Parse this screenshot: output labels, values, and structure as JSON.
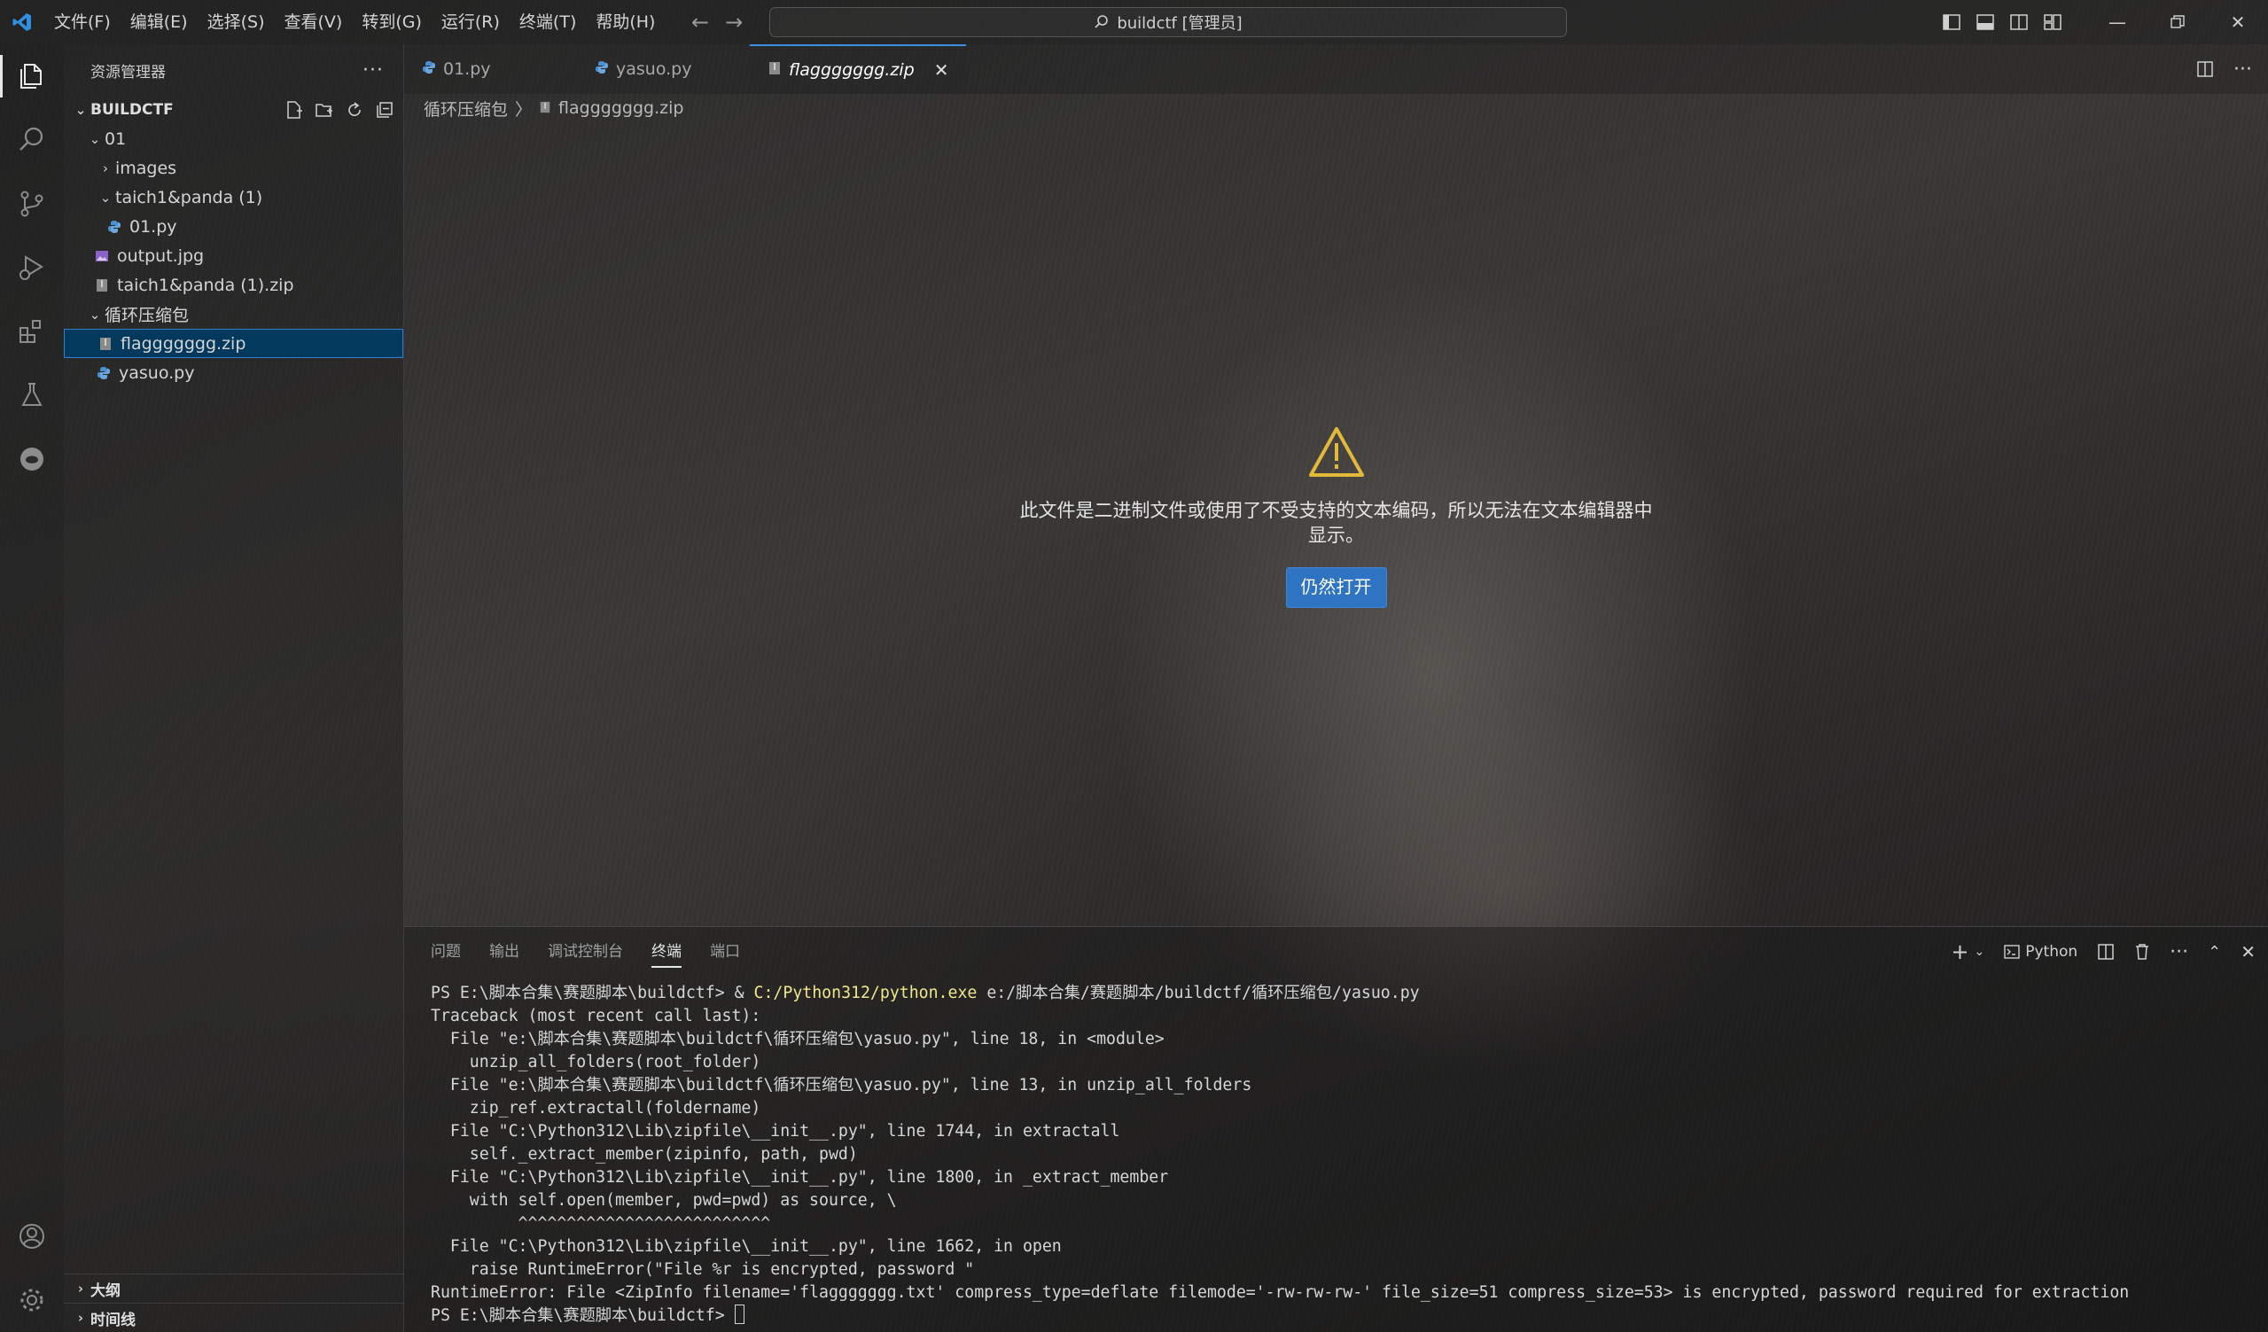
{
  "menu": [
    "文件(F)",
    "编辑(E)",
    "选择(S)",
    "查看(V)",
    "转到(G)",
    "运行(R)",
    "终端(T)",
    "帮助(H)"
  ],
  "command_center": {
    "text": "buildctf [管理员]",
    "icon": "search-icon"
  },
  "explorer": {
    "title": "资源管理器",
    "more": "···",
    "root": "BUILDCTF",
    "tree": [
      {
        "label": "01"
      },
      {
        "label": "images"
      },
      {
        "label": "taich1&panda (1)"
      },
      {
        "label": "01.py"
      },
      {
        "label": "output.jpg"
      },
      {
        "label": "taich1&panda (1).zip"
      },
      {
        "label": "循环压缩包"
      },
      {
        "label": "flaggggggg.zip"
      },
      {
        "label": "yasuo.py"
      }
    ],
    "bottom_sections": [
      "大纲",
      "时间线"
    ]
  },
  "tabs": [
    {
      "label": "01.py",
      "icon": "python-file-icon"
    },
    {
      "label": "yasuo.py",
      "icon": "python-file-icon"
    },
    {
      "label": "flaggggggg.zip",
      "icon": "zip-file-icon",
      "close": "✕"
    }
  ],
  "breadcrumb": {
    "folder": "循环压缩包",
    "sep": "〉",
    "file": "flaggggggg.zip"
  },
  "binary_notice": {
    "message": "此文件是二进制文件或使用了不受支持的文本编码，所以无法在文本编辑器中显示。",
    "button": "仍然打开"
  },
  "panel": {
    "tabs": [
      "问题",
      "输出",
      "调试控制台",
      "终端",
      "端口"
    ],
    "active_tab": "终端",
    "shell_label": "Python"
  },
  "terminal": {
    "prompt": "PS E:\\脚本合集\\赛题脚本\\buildctf> ",
    "first_cmd_amp": "& ",
    "first_cmd_exe": "C:/Python312/python.exe",
    "first_cmd_arg": " e:/脚本合集/赛题脚本/buildctf/循环压缩包/yasuo.py",
    "lines": [
      "Traceback (most recent call last):",
      "  File \"e:\\脚本合集\\赛题脚本\\buildctf\\循环压缩包\\yasuo.py\", line 18, in <module>",
      "    unzip_all_folders(root_folder)",
      "  File \"e:\\脚本合集\\赛题脚本\\buildctf\\循环压缩包\\yasuo.py\", line 13, in unzip_all_folders",
      "    zip_ref.extractall(foldername)",
      "  File \"C:\\Python312\\Lib\\zipfile\\__init__.py\", line 1744, in extractall",
      "    self._extract_member(zipinfo, path, pwd)",
      "  File \"C:\\Python312\\Lib\\zipfile\\__init__.py\", line 1800, in _extract_member",
      "    with self.open(member, pwd=pwd) as source, \\",
      "         ^^^^^^^^^^^^^^^^^^^^^^^^^^",
      "  File \"C:\\Python312\\Lib\\zipfile\\__init__.py\", line 1662, in open",
      "    raise RuntimeError(\"File %r is encrypted, password \"",
      "RuntimeError: File <ZipInfo filename='flaggggggg.txt' compress_type=deflate filemode='-rw-rw-rw-' file_size=51 compress_size=53> is encrypted, password required for extraction"
    ],
    "last_prompt": "PS E:\\脚本合集\\赛题脚本\\buildctf> "
  },
  "colors": {
    "accent": "#2f74c2",
    "warning": "#cca700",
    "selection": "#04395e"
  }
}
